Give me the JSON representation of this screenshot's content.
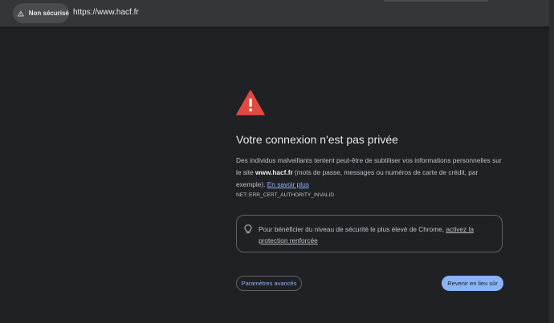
{
  "browser": {
    "security_chip": {
      "label": "Non sécurisé",
      "icon": "warning-triangle-icon"
    },
    "url": "https://www.hacf.fr"
  },
  "interstitial": {
    "icon": "warning-triangle-icon",
    "icon_color": "#e2493f",
    "title": "Votre connexion n'est pas privée",
    "description": {
      "before_site": "Des individus malveillants tentent peut-être de subtiliser vos informations personnelles sur le site ",
      "site": "www.hacf.fr",
      "after_site": " (mots de passe, messages ou numéros de carte de crédit, par exemple). ",
      "learn_more": "En savoir plus"
    },
    "error_code": "NET::ERR_CERT_AUTHORITY_INVALID",
    "enhanced_protection": {
      "icon": "lightbulb-icon",
      "text": "Pour bénéficier du niveau de sécurité le plus élevé de Chrome, ",
      "link": "activez la protection renforcée"
    },
    "buttons": {
      "advanced": "Paramètres avancés",
      "back_to_safety": "Revenir en lieu sûr"
    }
  },
  "colors": {
    "background": "#202124",
    "accent": "#8ab4f8",
    "text_primary": "#e8eaed",
    "text_secondary": "#bdc1c6"
  }
}
